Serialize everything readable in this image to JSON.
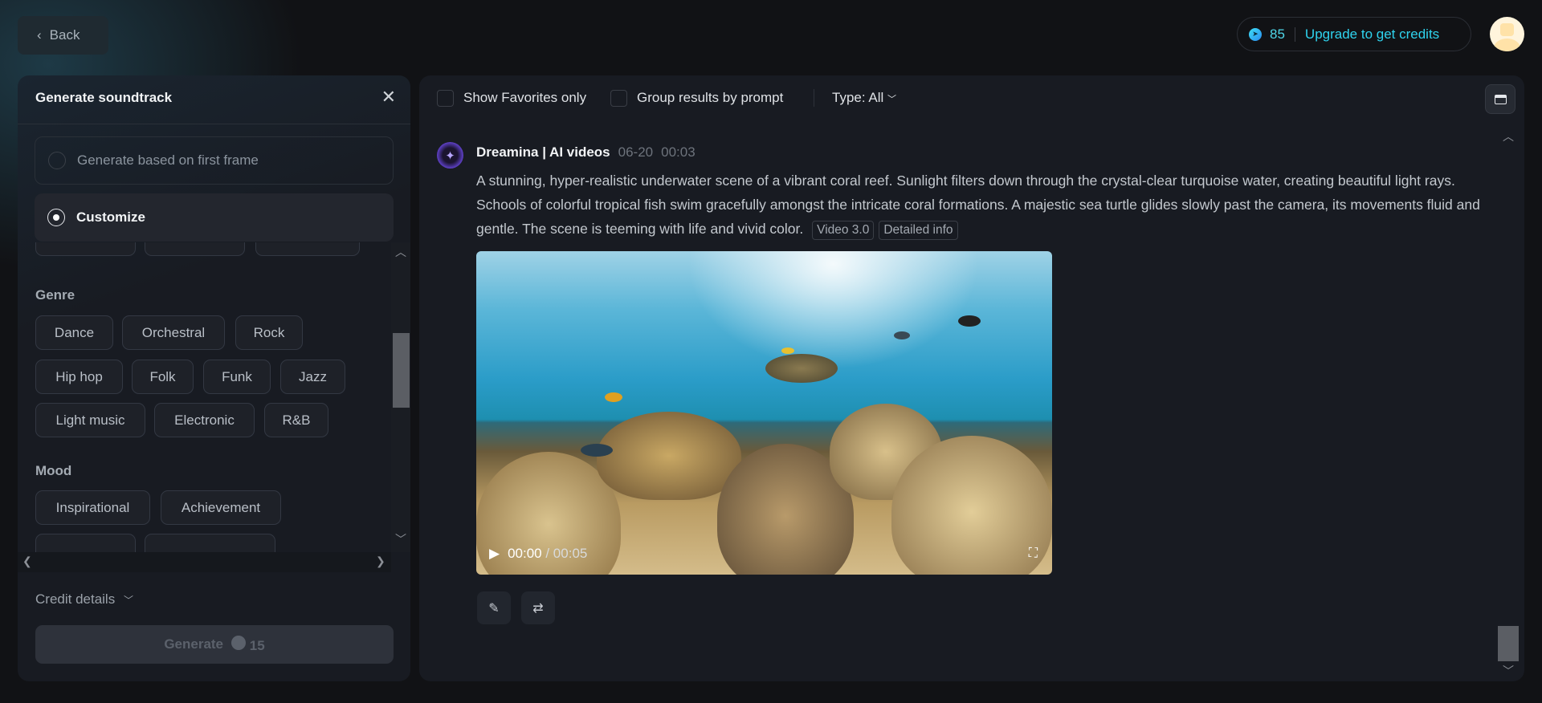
{
  "header": {
    "back_label": "Back",
    "credits": "85",
    "upgrade_label": "Upgrade to get credits"
  },
  "panel": {
    "title": "Generate soundtrack",
    "options": [
      {
        "label": "Generate based on first frame",
        "selected": false
      },
      {
        "label": "Customize",
        "selected": true
      }
    ],
    "genre_label": "Genre",
    "genres": [
      "Dance",
      "Orchestral",
      "Rock",
      "Hip hop",
      "Folk",
      "Funk",
      "Jazz",
      "Light music",
      "Electronic",
      "R&B"
    ],
    "mood_label": "Mood",
    "moods": [
      "Inspirational",
      "Achievement"
    ],
    "credit_details": "Credit details",
    "generate_label": "Generate",
    "generate_cost": "15"
  },
  "toolbar": {
    "favorites": "Show Favorites only",
    "group": "Group results by prompt",
    "type": "Type: All"
  },
  "result": {
    "author": "Dreamina | AI videos",
    "date": "06-20",
    "time": "00:03",
    "prompt": "A stunning, hyper-realistic underwater scene of a vibrant coral reef. Sunlight filters down through the crystal-clear turquoise water, creating beautiful light rays. Schools of colorful tropical fish swim gracefully amongst the intricate coral formations. A majestic sea turtle glides slowly past the camera, its movements fluid and gentle. The scene is teeming with life and vivid color.",
    "model_tag": "Video 3.0",
    "info_tag": "Detailed info",
    "current_time": "00:00",
    "duration": "/ 00:05"
  },
  "colors": {
    "accent": "#2fd3ee",
    "panel": "#181b22",
    "bg": "#111215"
  }
}
